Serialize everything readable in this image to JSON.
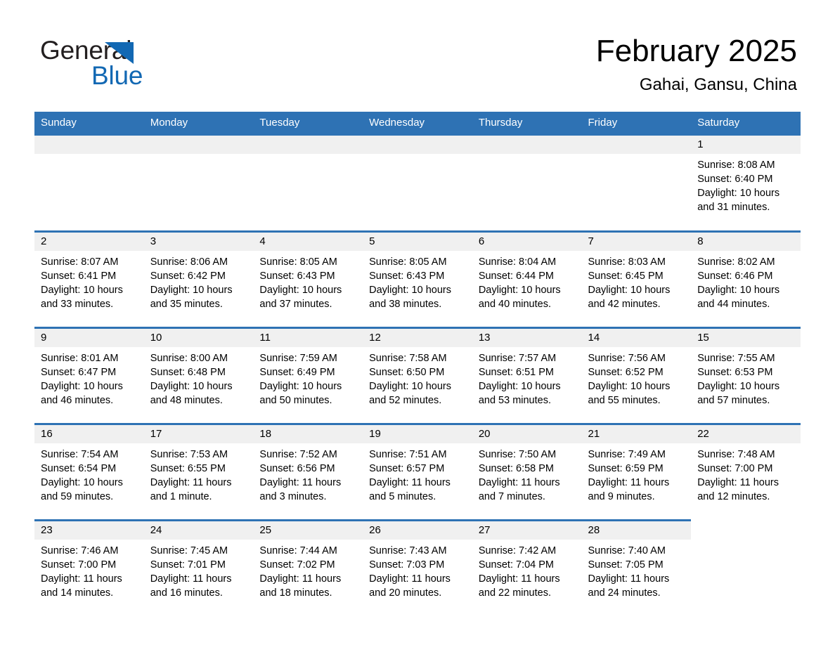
{
  "brand": {
    "name_part1": "General",
    "name_part2": "Blue",
    "triangle_color": "#1268b3"
  },
  "header": {
    "title": "February 2025",
    "subtitle": "Gahai, Gansu, China"
  },
  "colors": {
    "header_blue": "#2e72b4",
    "daynum_band": "#f0f0f0",
    "text": "#000000"
  },
  "weekdays": [
    "Sunday",
    "Monday",
    "Tuesday",
    "Wednesday",
    "Thursday",
    "Friday",
    "Saturday"
  ],
  "weeks": [
    [
      {
        "day": "",
        "sunrise": "",
        "sunset": "",
        "daylight_line1": "",
        "daylight_line2": "",
        "state": "empty-leading"
      },
      {
        "day": "",
        "sunrise": "",
        "sunset": "",
        "daylight_line1": "",
        "daylight_line2": "",
        "state": "empty-leading"
      },
      {
        "day": "",
        "sunrise": "",
        "sunset": "",
        "daylight_line1": "",
        "daylight_line2": "",
        "state": "empty-leading"
      },
      {
        "day": "",
        "sunrise": "",
        "sunset": "",
        "daylight_line1": "",
        "daylight_line2": "",
        "state": "empty-leading"
      },
      {
        "day": "",
        "sunrise": "",
        "sunset": "",
        "daylight_line1": "",
        "daylight_line2": "",
        "state": "empty-leading"
      },
      {
        "day": "",
        "sunrise": "",
        "sunset": "",
        "daylight_line1": "",
        "daylight_line2": "",
        "state": "empty-leading"
      },
      {
        "day": "1",
        "sunrise": "Sunrise: 8:08 AM",
        "sunset": "Sunset: 6:40 PM",
        "daylight_line1": "Daylight: 10 hours",
        "daylight_line2": "and 31 minutes.",
        "state": "filled"
      }
    ],
    [
      {
        "day": "2",
        "sunrise": "Sunrise: 8:07 AM",
        "sunset": "Sunset: 6:41 PM",
        "daylight_line1": "Daylight: 10 hours",
        "daylight_line2": "and 33 minutes.",
        "state": "filled"
      },
      {
        "day": "3",
        "sunrise": "Sunrise: 8:06 AM",
        "sunset": "Sunset: 6:42 PM",
        "daylight_line1": "Daylight: 10 hours",
        "daylight_line2": "and 35 minutes.",
        "state": "filled"
      },
      {
        "day": "4",
        "sunrise": "Sunrise: 8:05 AM",
        "sunset": "Sunset: 6:43 PM",
        "daylight_line1": "Daylight: 10 hours",
        "daylight_line2": "and 37 minutes.",
        "state": "filled"
      },
      {
        "day": "5",
        "sunrise": "Sunrise: 8:05 AM",
        "sunset": "Sunset: 6:43 PM",
        "daylight_line1": "Daylight: 10 hours",
        "daylight_line2": "and 38 minutes.",
        "state": "filled"
      },
      {
        "day": "6",
        "sunrise": "Sunrise: 8:04 AM",
        "sunset": "Sunset: 6:44 PM",
        "daylight_line1": "Daylight: 10 hours",
        "daylight_line2": "and 40 minutes.",
        "state": "filled"
      },
      {
        "day": "7",
        "sunrise": "Sunrise: 8:03 AM",
        "sunset": "Sunset: 6:45 PM",
        "daylight_line1": "Daylight: 10 hours",
        "daylight_line2": "and 42 minutes.",
        "state": "filled"
      },
      {
        "day": "8",
        "sunrise": "Sunrise: 8:02 AM",
        "sunset": "Sunset: 6:46 PM",
        "daylight_line1": "Daylight: 10 hours",
        "daylight_line2": "and 44 minutes.",
        "state": "filled"
      }
    ],
    [
      {
        "day": "9",
        "sunrise": "Sunrise: 8:01 AM",
        "sunset": "Sunset: 6:47 PM",
        "daylight_line1": "Daylight: 10 hours",
        "daylight_line2": "and 46 minutes.",
        "state": "filled"
      },
      {
        "day": "10",
        "sunrise": "Sunrise: 8:00 AM",
        "sunset": "Sunset: 6:48 PM",
        "daylight_line1": "Daylight: 10 hours",
        "daylight_line2": "and 48 minutes.",
        "state": "filled"
      },
      {
        "day": "11",
        "sunrise": "Sunrise: 7:59 AM",
        "sunset": "Sunset: 6:49 PM",
        "daylight_line1": "Daylight: 10 hours",
        "daylight_line2": "and 50 minutes.",
        "state": "filled"
      },
      {
        "day": "12",
        "sunrise": "Sunrise: 7:58 AM",
        "sunset": "Sunset: 6:50 PM",
        "daylight_line1": "Daylight: 10 hours",
        "daylight_line2": "and 52 minutes.",
        "state": "filled"
      },
      {
        "day": "13",
        "sunrise": "Sunrise: 7:57 AM",
        "sunset": "Sunset: 6:51 PM",
        "daylight_line1": "Daylight: 10 hours",
        "daylight_line2": "and 53 minutes.",
        "state": "filled"
      },
      {
        "day": "14",
        "sunrise": "Sunrise: 7:56 AM",
        "sunset": "Sunset: 6:52 PM",
        "daylight_line1": "Daylight: 10 hours",
        "daylight_line2": "and 55 minutes.",
        "state": "filled"
      },
      {
        "day": "15",
        "sunrise": "Sunrise: 7:55 AM",
        "sunset": "Sunset: 6:53 PM",
        "daylight_line1": "Daylight: 10 hours",
        "daylight_line2": "and 57 minutes.",
        "state": "filled"
      }
    ],
    [
      {
        "day": "16",
        "sunrise": "Sunrise: 7:54 AM",
        "sunset": "Sunset: 6:54 PM",
        "daylight_line1": "Daylight: 10 hours",
        "daylight_line2": "and 59 minutes.",
        "state": "filled"
      },
      {
        "day": "17",
        "sunrise": "Sunrise: 7:53 AM",
        "sunset": "Sunset: 6:55 PM",
        "daylight_line1": "Daylight: 11 hours",
        "daylight_line2": "and 1 minute.",
        "state": "filled"
      },
      {
        "day": "18",
        "sunrise": "Sunrise: 7:52 AM",
        "sunset": "Sunset: 6:56 PM",
        "daylight_line1": "Daylight: 11 hours",
        "daylight_line2": "and 3 minutes.",
        "state": "filled"
      },
      {
        "day": "19",
        "sunrise": "Sunrise: 7:51 AM",
        "sunset": "Sunset: 6:57 PM",
        "daylight_line1": "Daylight: 11 hours",
        "daylight_line2": "and 5 minutes.",
        "state": "filled"
      },
      {
        "day": "20",
        "sunrise": "Sunrise: 7:50 AM",
        "sunset": "Sunset: 6:58 PM",
        "daylight_line1": "Daylight: 11 hours",
        "daylight_line2": "and 7 minutes.",
        "state": "filled"
      },
      {
        "day": "21",
        "sunrise": "Sunrise: 7:49 AM",
        "sunset": "Sunset: 6:59 PM",
        "daylight_line1": "Daylight: 11 hours",
        "daylight_line2": "and 9 minutes.",
        "state": "filled"
      },
      {
        "day": "22",
        "sunrise": "Sunrise: 7:48 AM",
        "sunset": "Sunset: 7:00 PM",
        "daylight_line1": "Daylight: 11 hours",
        "daylight_line2": "and 12 minutes.",
        "state": "filled"
      }
    ],
    [
      {
        "day": "23",
        "sunrise": "Sunrise: 7:46 AM",
        "sunset": "Sunset: 7:00 PM",
        "daylight_line1": "Daylight: 11 hours",
        "daylight_line2": "and 14 minutes.",
        "state": "filled"
      },
      {
        "day": "24",
        "sunrise": "Sunrise: 7:45 AM",
        "sunset": "Sunset: 7:01 PM",
        "daylight_line1": "Daylight: 11 hours",
        "daylight_line2": "and 16 minutes.",
        "state": "filled"
      },
      {
        "day": "25",
        "sunrise": "Sunrise: 7:44 AM",
        "sunset": "Sunset: 7:02 PM",
        "daylight_line1": "Daylight: 11 hours",
        "daylight_line2": "and 18 minutes.",
        "state": "filled"
      },
      {
        "day": "26",
        "sunrise": "Sunrise: 7:43 AM",
        "sunset": "Sunset: 7:03 PM",
        "daylight_line1": "Daylight: 11 hours",
        "daylight_line2": "and 20 minutes.",
        "state": "filled"
      },
      {
        "day": "27",
        "sunrise": "Sunrise: 7:42 AM",
        "sunset": "Sunset: 7:04 PM",
        "daylight_line1": "Daylight: 11 hours",
        "daylight_line2": "and 22 minutes.",
        "state": "filled"
      },
      {
        "day": "28",
        "sunrise": "Sunrise: 7:40 AM",
        "sunset": "Sunset: 7:05 PM",
        "daylight_line1": "Daylight: 11 hours",
        "daylight_line2": "and 24 minutes.",
        "state": "filled"
      },
      {
        "day": "",
        "sunrise": "",
        "sunset": "",
        "daylight_line1": "",
        "daylight_line2": "",
        "state": "blank"
      }
    ]
  ]
}
